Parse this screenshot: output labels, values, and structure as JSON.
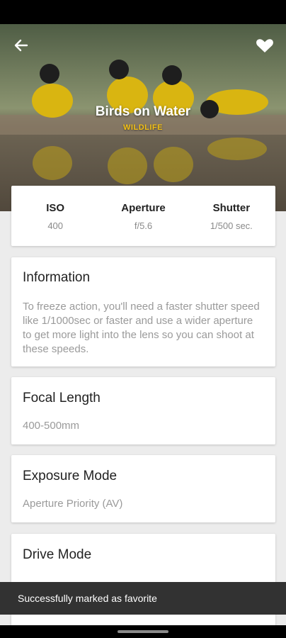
{
  "photo": {
    "title": "Birds on Water",
    "category": "WILDLIFE"
  },
  "icons": {
    "back": "arrow-left-icon",
    "favorite": "heart-icon"
  },
  "settings": [
    {
      "label": "ISO",
      "value": "400"
    },
    {
      "label": "Aperture",
      "value": "f/5.6"
    },
    {
      "label": "Shutter",
      "value": "1/500 sec."
    }
  ],
  "information": {
    "title": "Information",
    "body": "To freeze action, you'll need a faster shutter speed like 1/1000sec or faster and use a wider aperture to get more light into the lens so you can shoot at these speeds."
  },
  "focal_length": {
    "title": "Focal Length",
    "value": "400-500mm"
  },
  "exposure_mode": {
    "title": "Exposure Mode",
    "value": "Aperture Priority (AV)"
  },
  "drive_mode": {
    "title": "Drive Mode",
    "value": ""
  },
  "snackbar": {
    "message": "Successfully marked as favorite"
  },
  "colors": {
    "category": "#f2c015",
    "snackbar": "#323232",
    "background": "#ececec"
  }
}
